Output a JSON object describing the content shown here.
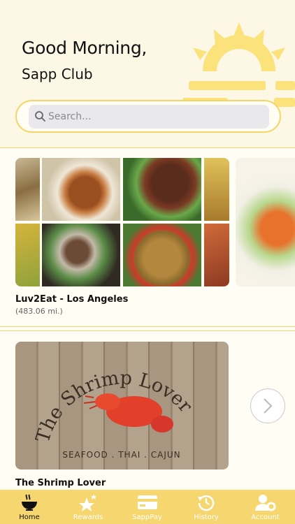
{
  "header": {
    "greeting": "Good Morning,",
    "user_name": "Sapp Club"
  },
  "search": {
    "placeholder": "Search..."
  },
  "restaurants": [
    {
      "name": "Luv2Eat - Los Angeles",
      "distance": "(483.06 mi.)"
    },
    {
      "name": "The Shrimp Lover",
      "logo_text": "The Shrimp Lover",
      "logo_subtext": "SEAFOOD . THAI . CAJUN"
    }
  ],
  "tabs": [
    {
      "label": "Home",
      "icon": "bowl-icon",
      "active": true
    },
    {
      "label": "Rewards",
      "icon": "stars-icon",
      "active": false
    },
    {
      "label": "SappPay",
      "icon": "card-icon",
      "active": false
    },
    {
      "label": "History",
      "icon": "history-icon",
      "active": false
    },
    {
      "label": "Account",
      "icon": "account-gear-icon",
      "active": false
    }
  ],
  "colors": {
    "accent": "#f6d66f",
    "header_bg": "#fdf8e6",
    "sun": "#fbe27a"
  }
}
